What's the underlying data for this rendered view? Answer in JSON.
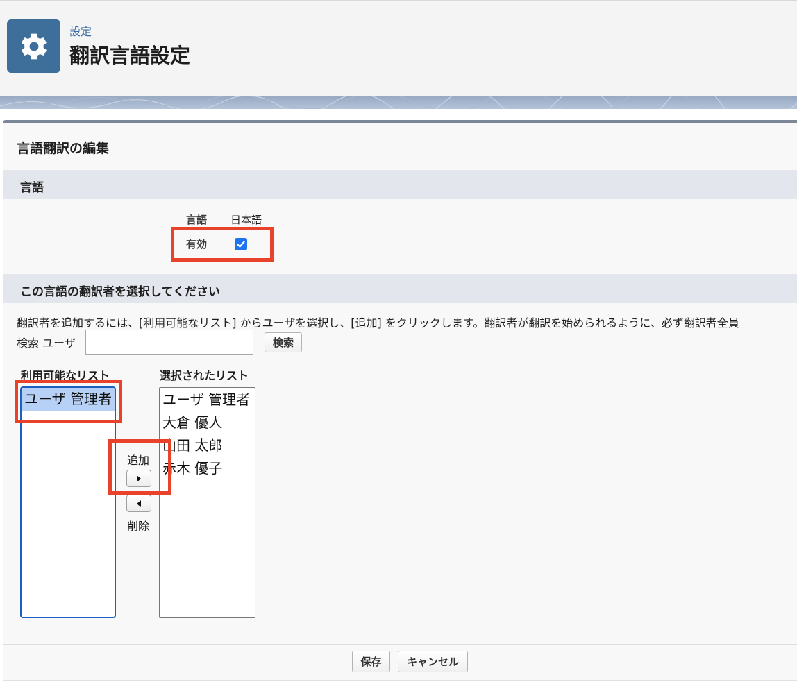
{
  "header": {
    "breadcrumb": "設定",
    "title": "翻訳言語設定",
    "icon": "gear-icon",
    "icon_color": "#3e6e9a"
  },
  "panel": {
    "title": "言語翻訳の編集",
    "language_section": {
      "header": "言語",
      "language_label": "言語",
      "language_value": "日本語",
      "active_label": "有効",
      "active_checked": true
    },
    "translator_section": {
      "header": "この言語の翻訳者を選択してください",
      "instruction": "翻訳者を追加するには、[利用可能なリスト] からユーザを選択し、[追加] をクリックします。翻訳者が翻訳を始められるように、必ず翻訳者全員",
      "search_label": "検索 ユーザ",
      "search_value": "",
      "search_button": "検索",
      "available_title": "利用可能なリスト",
      "available_items": [
        "ユーザ 管理者"
      ],
      "selected_title": "選択されたリスト",
      "selected_items": [
        "ユーザ 管理者",
        "大倉 優人",
        "山田 太郎",
        "赤木 優子"
      ],
      "add_label": "追加",
      "remove_label": "削除"
    },
    "footer": {
      "save_button": "保存",
      "cancel_button": "キャンセル"
    }
  },
  "colors": {
    "highlight_box": "#e8422b",
    "checkbox": "#1f73f0",
    "selected_item": "#b6d1f5"
  }
}
